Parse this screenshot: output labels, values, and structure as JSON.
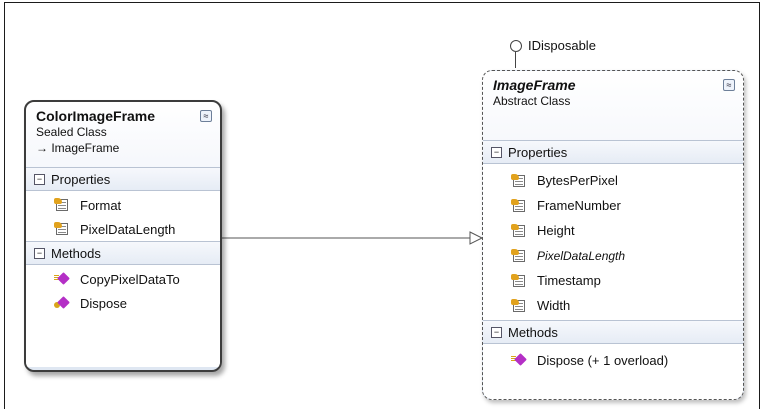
{
  "interface": {
    "label": "IDisposable"
  },
  "color_image_frame": {
    "name": "ColorImageFrame",
    "kind": "Sealed Class",
    "base": "→ ImageFrame",
    "collapse_glyph": "≈",
    "properties_label": "Properties",
    "methods_label": "Methods",
    "properties": [
      {
        "label": "Format",
        "icon": "property-icon"
      },
      {
        "label": "PixelDataLength",
        "icon": "property-icon"
      }
    ],
    "methods": [
      {
        "label": "CopyPixelDataTo",
        "icon": "method-icon"
      },
      {
        "label": "Dispose",
        "icon": "private-method-icon"
      }
    ]
  },
  "image_frame": {
    "name": "ImageFrame",
    "kind": "Abstract Class",
    "collapse_glyph": "≈",
    "properties_label": "Properties",
    "methods_label": "Methods",
    "properties": [
      {
        "label": "BytesPerPixel",
        "icon": "property-icon"
      },
      {
        "label": "FrameNumber",
        "icon": "property-icon"
      },
      {
        "label": "Height",
        "icon": "property-icon"
      },
      {
        "label": "PixelDataLength",
        "icon": "property-icon",
        "italic": true
      },
      {
        "label": "Timestamp",
        "icon": "property-icon"
      },
      {
        "label": "Width",
        "icon": "property-icon"
      }
    ],
    "methods": [
      {
        "label": "Dispose (+ 1 overload)",
        "icon": "method-icon"
      }
    ]
  },
  "toggle_glyph": "−"
}
